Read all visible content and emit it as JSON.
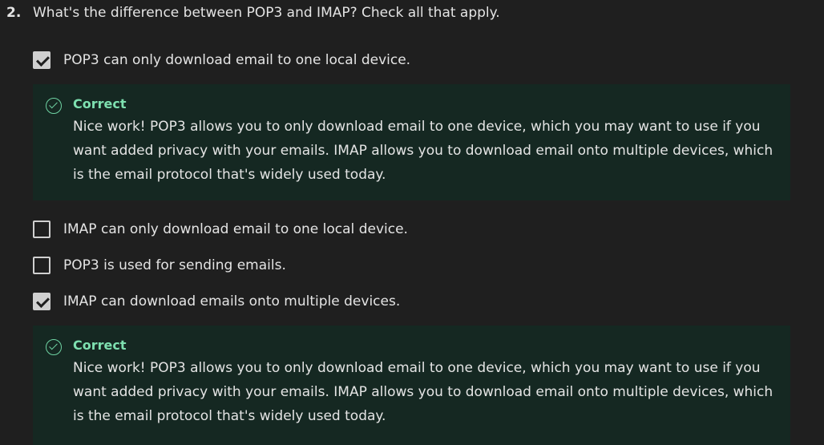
{
  "question": {
    "number": "2.",
    "text": "What's the difference between POP3 and IMAP? Check all that apply."
  },
  "options": [
    {
      "label": "POP3 can only download email to one local device.",
      "checked": true,
      "feedback": {
        "title": "Correct",
        "body": "Nice work! POP3 allows you to only download email to one device, which you may want to use if you want added privacy with your emails. IMAP allows you to download email onto multiple devices, which is the email protocol that's widely used today."
      }
    },
    {
      "label": "IMAP can only download email to one local device.",
      "checked": false
    },
    {
      "label": "POP3 is used for sending emails.",
      "checked": false
    },
    {
      "label": "IMAP can download emails onto multiple devices.",
      "checked": true,
      "feedback": {
        "title": "Correct",
        "body": "Nice work! POP3 allows you to only download email to one device, which you may want to use if you want added privacy with your emails. IMAP allows you to download email onto multiple devices, which is the email protocol that's widely used today."
      }
    }
  ],
  "colors": {
    "background": "#1f1f1f",
    "feedback_background": "#152822",
    "correct_accent": "#7ee0b0",
    "text": "#e4e4e4"
  }
}
